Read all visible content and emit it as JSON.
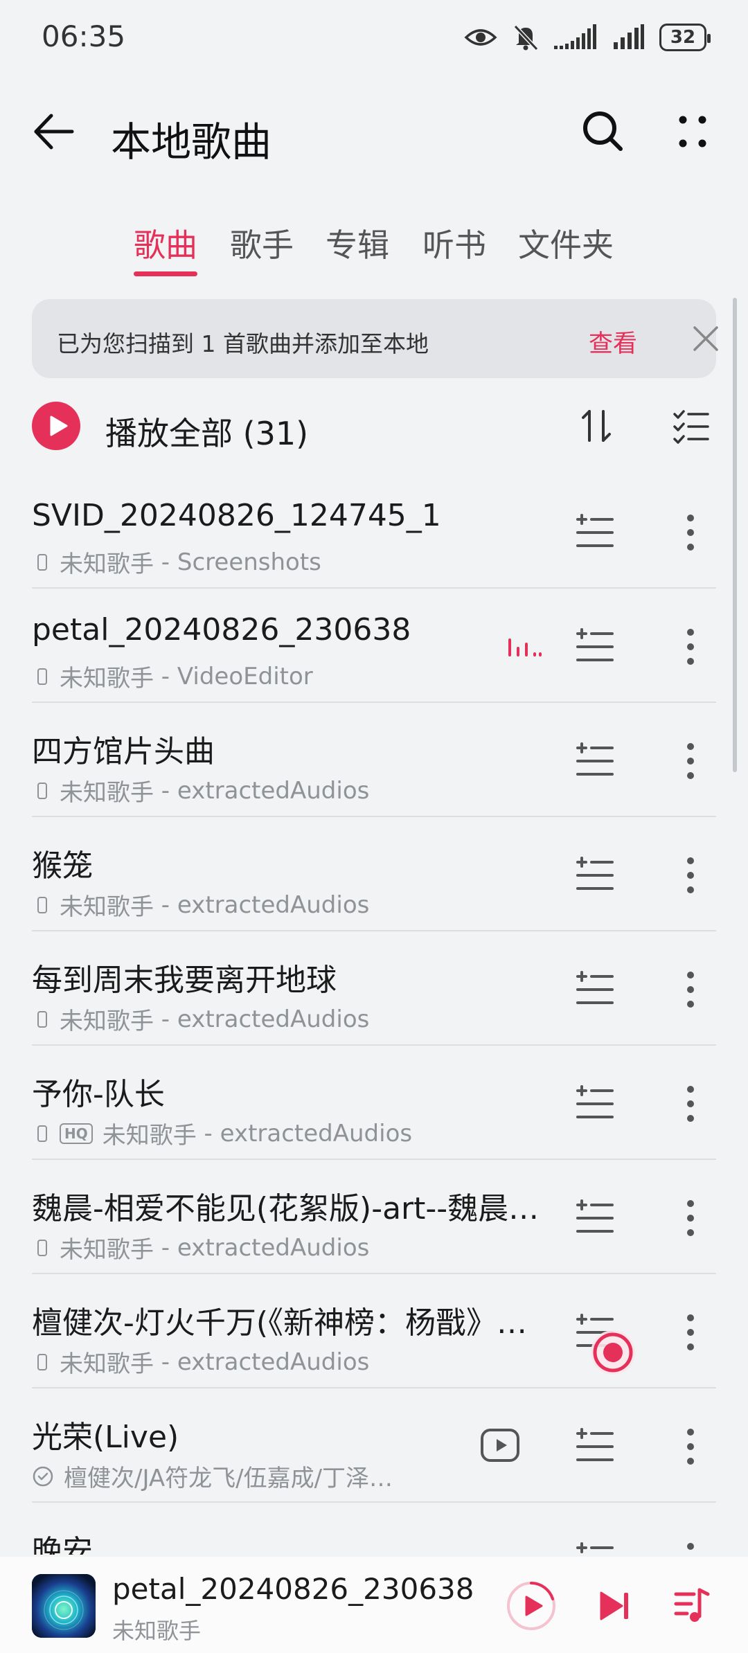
{
  "status_bar": {
    "time": "06:35",
    "battery": "32",
    "icons": [
      "eye-icon",
      "mute-icon",
      "signal-icon",
      "signal-icon",
      "battery-icon"
    ]
  },
  "header": {
    "title": "本地歌曲",
    "back_icon": "arrow-left-icon",
    "search_icon": "search-icon",
    "more_icon": "more-dots-icon"
  },
  "tabs": [
    {
      "label": "歌曲",
      "active": true
    },
    {
      "label": "歌手",
      "active": false
    },
    {
      "label": "专辑",
      "active": false
    },
    {
      "label": "听书",
      "active": false
    },
    {
      "label": "文件夹",
      "active": false
    }
  ],
  "notice": {
    "text": "已为您扫描到 1 首歌曲并添加至本地",
    "link": "查看",
    "close_icon": "close-icon"
  },
  "play_all": {
    "label": "播放全部 (31)",
    "icons": [
      "play-circle-icon",
      "sort-icon",
      "multi-select-icon"
    ]
  },
  "songs": [
    {
      "title": "SVID_20240826_124745_1",
      "artist": "未知歌手",
      "source": "Screenshots"
    },
    {
      "title": "petal_20240826_230638",
      "artist": "未知歌手",
      "source": "VideoEditor",
      "playing": true
    },
    {
      "title": "四方馆片头曲",
      "artist": "未知歌手",
      "source": "extractedAudios"
    },
    {
      "title": "猴笼",
      "artist": "未知歌手",
      "source": "extractedAudios"
    },
    {
      "title": "每到周末我要离开地球",
      "artist": "未知歌手",
      "source": "extractedAudios"
    },
    {
      "title": "予你-队长",
      "artist": "未知歌手",
      "source": "extractedAudios",
      "hq": "HQ"
    },
    {
      "title": "魏晨-相爱不能见(花絮版)-art--魏晨…",
      "artist": "未知歌手",
      "source": "extractedAudios"
    },
    {
      "title": "檀健次-灯火千万(《新神榜：杨戬》…",
      "artist": "未知歌手",
      "source": "extractedAudios"
    },
    {
      "title": "光荣(Live)",
      "artist": "檀健次/JA符龙飞/伍嘉成/丁泽…",
      "source": "",
      "mv": true
    },
    {
      "title": "晚安",
      "artist": "",
      "source": ""
    }
  ],
  "row_separator": " - ",
  "mini_player": {
    "title": "petal_20240826_230638",
    "artist": "未知歌手",
    "icons": [
      "play-icon",
      "next-icon",
      "queue-icon"
    ]
  },
  "colors": {
    "accent": "#e5305a",
    "background": "#f1f3f5",
    "notice_bg": "#e2e4e7",
    "text_secondary": "#8f9297"
  }
}
